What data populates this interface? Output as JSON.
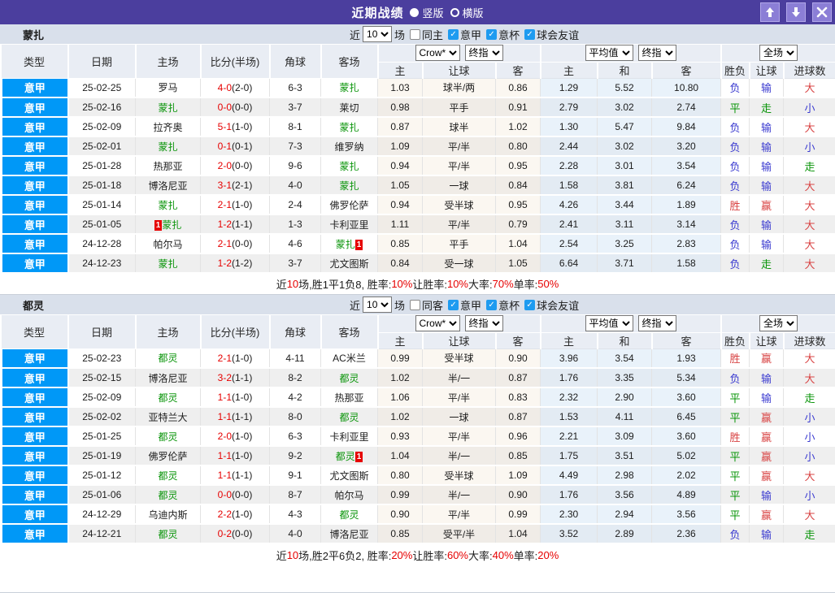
{
  "header": {
    "title": "近期战绩",
    "radio_vertical": "竖版",
    "radio_horizontal": "横版"
  },
  "filters": {
    "near": "近",
    "count": "10",
    "games": "场",
    "leagues": [
      "意甲",
      "意杯",
      "球会友谊"
    ]
  },
  "table_header": {
    "left_cols": [
      "类型",
      "日期",
      "主场",
      "比分(半场)",
      "角球",
      "客场"
    ],
    "sub_cols": [
      "主",
      "让球",
      "客",
      "主",
      "和",
      "客",
      "胜负",
      "让球",
      "进球数"
    ],
    "selects": {
      "bookmaker": "Crow*",
      "final1": "终指",
      "average": "平均值",
      "final2": "终指",
      "scope": "全场"
    }
  },
  "sections": [
    {
      "team": "蒙扎",
      "same_filter_label": "同主",
      "rows": [
        {
          "lg": "意甲",
          "dt": "25-02-25",
          "h": "罗马",
          "hf": false,
          "sf": "4-0",
          "sh": "(2-0)",
          "cn": "6-3",
          "a": "蒙扎",
          "af": true,
          "ah": [
            "1.03",
            "球半/两",
            "0.86"
          ],
          "eu": [
            "1.29",
            "5.52",
            "10.80"
          ],
          "rs": [
            "负",
            "输",
            "大"
          ]
        },
        {
          "lg": "意甲",
          "dt": "25-02-16",
          "h": "蒙扎",
          "hf": true,
          "sf": "0-0",
          "sh": "(0-0)",
          "cn": "3-7",
          "a": "莱切",
          "af": false,
          "ah": [
            "0.98",
            "平手",
            "0.91"
          ],
          "eu": [
            "2.79",
            "3.02",
            "2.74"
          ],
          "rs": [
            "平",
            "走",
            "小"
          ]
        },
        {
          "lg": "意甲",
          "dt": "25-02-09",
          "h": "拉齐奥",
          "hf": false,
          "sf": "5-1",
          "sh": "(1-0)",
          "cn": "8-1",
          "a": "蒙扎",
          "af": true,
          "ah": [
            "0.87",
            "球半",
            "1.02"
          ],
          "eu": [
            "1.30",
            "5.47",
            "9.84"
          ],
          "rs": [
            "负",
            "输",
            "大"
          ]
        },
        {
          "lg": "意甲",
          "dt": "25-02-01",
          "h": "蒙扎",
          "hf": true,
          "sf": "0-1",
          "sh": "(0-1)",
          "cn": "7-3",
          "a": "维罗纳",
          "af": false,
          "ah": [
            "1.09",
            "平/半",
            "0.80"
          ],
          "eu": [
            "2.44",
            "3.02",
            "3.20"
          ],
          "rs": [
            "负",
            "输",
            "小"
          ]
        },
        {
          "lg": "意甲",
          "dt": "25-01-28",
          "h": "热那亚",
          "hf": false,
          "sf": "2-0",
          "sh": "(0-0)",
          "cn": "9-6",
          "a": "蒙扎",
          "af": true,
          "ah": [
            "0.94",
            "平/半",
            "0.95"
          ],
          "eu": [
            "2.28",
            "3.01",
            "3.54"
          ],
          "rs": [
            "负",
            "输",
            "走"
          ]
        },
        {
          "lg": "意甲",
          "dt": "25-01-18",
          "h": "博洛尼亚",
          "hf": false,
          "sf": "3-1",
          "sh": "(2-1)",
          "cn": "4-0",
          "a": "蒙扎",
          "af": true,
          "ah": [
            "1.05",
            "一球",
            "0.84"
          ],
          "eu": [
            "1.58",
            "3.81",
            "6.24"
          ],
          "rs": [
            "负",
            "输",
            "大"
          ]
        },
        {
          "lg": "意甲",
          "dt": "25-01-14",
          "h": "蒙扎",
          "hf": true,
          "sf": "2-1",
          "sh": "(1-0)",
          "cn": "2-4",
          "a": "佛罗伦萨",
          "af": false,
          "ah": [
            "0.94",
            "受半球",
            "0.95"
          ],
          "eu": [
            "4.26",
            "3.44",
            "1.89"
          ],
          "rs": [
            "胜",
            "赢",
            "大"
          ]
        },
        {
          "lg": "意甲",
          "dt": "25-01-05",
          "h": "蒙扎",
          "hf": true,
          "hb": "1",
          "hbp": "before",
          "sf": "1-2",
          "sh": "(1-1)",
          "cn": "1-3",
          "a": "卡利亚里",
          "af": false,
          "ah": [
            "1.11",
            "平/半",
            "0.79"
          ],
          "eu": [
            "2.41",
            "3.11",
            "3.14"
          ],
          "rs": [
            "负",
            "输",
            "大"
          ]
        },
        {
          "lg": "意甲",
          "dt": "24-12-28",
          "h": "帕尔马",
          "hf": false,
          "sf": "2-1",
          "sh": "(0-0)",
          "cn": "4-6",
          "a": "蒙扎",
          "af": true,
          "ab": "1",
          "abp": "after",
          "ah": [
            "0.85",
            "平手",
            "1.04"
          ],
          "eu": [
            "2.54",
            "3.25",
            "2.83"
          ],
          "rs": [
            "负",
            "输",
            "大"
          ]
        },
        {
          "lg": "意甲",
          "dt": "24-12-23",
          "h": "蒙扎",
          "hf": true,
          "sf": "1-2",
          "sh": "(1-2)",
          "cn": "3-7",
          "a": "尤文图斯",
          "af": false,
          "ah": [
            "0.84",
            "受一球",
            "1.05"
          ],
          "eu": [
            "6.64",
            "3.71",
            "1.58"
          ],
          "rs": [
            "负",
            "走",
            "大"
          ]
        }
      ],
      "summary": [
        {
          "t": "近"
        },
        {
          "t": "10",
          "red": true
        },
        {
          "t": "场,胜1平1负8, 胜率:"
        },
        {
          "t": "10%",
          "red": true
        },
        {
          "t": " 让胜率:"
        },
        {
          "t": "10%",
          "red": true
        },
        {
          "t": " 大率:"
        },
        {
          "t": "70%",
          "red": true
        },
        {
          "t": " 单率:"
        },
        {
          "t": "50%",
          "red": true
        }
      ]
    },
    {
      "team": "都灵",
      "same_filter_label": "同客",
      "rows": [
        {
          "lg": "意甲",
          "dt": "25-02-23",
          "h": "都灵",
          "hf": true,
          "sf": "2-1",
          "sh": "(1-0)",
          "cn": "4-11",
          "a": "AC米兰",
          "af": false,
          "ah": [
            "0.99",
            "受半球",
            "0.90"
          ],
          "eu": [
            "3.96",
            "3.54",
            "1.93"
          ],
          "rs": [
            "胜",
            "赢",
            "大"
          ]
        },
        {
          "lg": "意甲",
          "dt": "25-02-15",
          "h": "博洛尼亚",
          "hf": false,
          "sf": "3-2",
          "sh": "(1-1)",
          "cn": "8-2",
          "a": "都灵",
          "af": true,
          "ah": [
            "1.02",
            "半/一",
            "0.87"
          ],
          "eu": [
            "1.76",
            "3.35",
            "5.34"
          ],
          "rs": [
            "负",
            "输",
            "大"
          ]
        },
        {
          "lg": "意甲",
          "dt": "25-02-09",
          "h": "都灵",
          "hf": true,
          "sf": "1-1",
          "sh": "(1-0)",
          "cn": "4-2",
          "a": "热那亚",
          "af": false,
          "ah": [
            "1.06",
            "平/半",
            "0.83"
          ],
          "eu": [
            "2.32",
            "2.90",
            "3.60"
          ],
          "rs": [
            "平",
            "输",
            "走"
          ]
        },
        {
          "lg": "意甲",
          "dt": "25-02-02",
          "h": "亚特兰大",
          "hf": false,
          "sf": "1-1",
          "sh": "(1-1)",
          "cn": "8-0",
          "a": "都灵",
          "af": true,
          "ah": [
            "1.02",
            "一球",
            "0.87"
          ],
          "eu": [
            "1.53",
            "4.11",
            "6.45"
          ],
          "rs": [
            "平",
            "赢",
            "小"
          ]
        },
        {
          "lg": "意甲",
          "dt": "25-01-25",
          "h": "都灵",
          "hf": true,
          "sf": "2-0",
          "sh": "(1-0)",
          "cn": "6-3",
          "a": "卡利亚里",
          "af": false,
          "ah": [
            "0.93",
            "平/半",
            "0.96"
          ],
          "eu": [
            "2.21",
            "3.09",
            "3.60"
          ],
          "rs": [
            "胜",
            "赢",
            "小"
          ]
        },
        {
          "lg": "意甲",
          "dt": "25-01-19",
          "h": "佛罗伦萨",
          "hf": false,
          "sf": "1-1",
          "sh": "(1-0)",
          "cn": "9-2",
          "a": "都灵",
          "af": true,
          "ab": "1",
          "abp": "after",
          "ah": [
            "1.04",
            "半/一",
            "0.85"
          ],
          "eu": [
            "1.75",
            "3.51",
            "5.02"
          ],
          "rs": [
            "平",
            "赢",
            "小"
          ]
        },
        {
          "lg": "意甲",
          "dt": "25-01-12",
          "h": "都灵",
          "hf": true,
          "sf": "1-1",
          "sh": "(1-1)",
          "cn": "9-1",
          "a": "尤文图斯",
          "af": false,
          "ah": [
            "0.80",
            "受半球",
            "1.09"
          ],
          "eu": [
            "4.49",
            "2.98",
            "2.02"
          ],
          "rs": [
            "平",
            "赢",
            "大"
          ]
        },
        {
          "lg": "意甲",
          "dt": "25-01-06",
          "h": "都灵",
          "hf": true,
          "sf": "0-0",
          "sh": "(0-0)",
          "cn": "8-7",
          "a": "帕尔马",
          "af": false,
          "ah": [
            "0.99",
            "半/一",
            "0.90"
          ],
          "eu": [
            "1.76",
            "3.56",
            "4.89"
          ],
          "rs": [
            "平",
            "输",
            "小"
          ]
        },
        {
          "lg": "意甲",
          "dt": "24-12-29",
          "h": "乌迪内斯",
          "hf": false,
          "sf": "2-2",
          "sh": "(1-0)",
          "cn": "4-3",
          "a": "都灵",
          "af": true,
          "ah": [
            "0.90",
            "平/半",
            "0.99"
          ],
          "eu": [
            "2.30",
            "2.94",
            "3.56"
          ],
          "rs": [
            "平",
            "赢",
            "大"
          ]
        },
        {
          "lg": "意甲",
          "dt": "24-12-21",
          "h": "都灵",
          "hf": true,
          "sf": "0-2",
          "sh": "(0-0)",
          "cn": "4-0",
          "a": "博洛尼亚",
          "af": false,
          "ah": [
            "0.85",
            "受平/半",
            "1.04"
          ],
          "eu": [
            "3.52",
            "2.89",
            "2.36"
          ],
          "rs": [
            "负",
            "输",
            "走"
          ]
        }
      ],
      "summary": [
        {
          "t": "近"
        },
        {
          "t": "10",
          "red": true
        },
        {
          "t": "场,胜2平6负2, 胜率:"
        },
        {
          "t": "20%",
          "red": true
        },
        {
          "t": " 让胜率:"
        },
        {
          "t": "60%",
          "red": true
        },
        {
          "t": " 大率:"
        },
        {
          "t": "40%",
          "red": true
        },
        {
          "t": " 单率:"
        },
        {
          "t": "20%",
          "red": true
        }
      ]
    }
  ]
}
